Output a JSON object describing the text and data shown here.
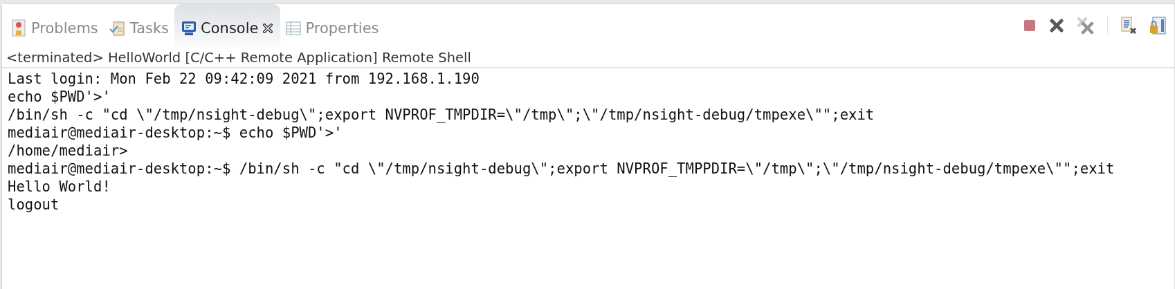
{
  "tabs": [
    {
      "label": "Problems",
      "kind": "problems",
      "selected": false
    },
    {
      "label": "Tasks",
      "kind": "tasks",
      "selected": false
    },
    {
      "label": "Console",
      "kind": "console",
      "selected": true
    },
    {
      "label": "Properties",
      "kind": "properties",
      "selected": false
    }
  ],
  "toolbar": [
    {
      "kind": "terminate",
      "disabled": true
    },
    {
      "kind": "remove",
      "disabled": false
    },
    {
      "kind": "remove-all",
      "disabled": true
    },
    {
      "kind": "clear",
      "disabled": false
    },
    {
      "kind": "scroll-lock",
      "disabled": false
    }
  ],
  "console": {
    "header": "<terminated> HelloWorld [C/C++ Remote Application] Remote Shell",
    "lines": [
      "Last login: Mon Feb 22 09:42:09 2021 from 192.168.1.190",
      "echo $PWD'>'",
      "/bin/sh -c \"cd \\\"/tmp/nsight-debug\\\";export NVPROF_TMPDIR=\\\"/tmp\\\";\\\"/tmp/nsight-debug/tmpexe\\\"\";exit",
      "mediair@mediair-desktop:~$ echo $PWD'>'",
      "/home/mediair>",
      "mediair@mediair-desktop:~$ /bin/sh -c \"cd \\\"/tmp/nsight-debug\\\";export NVPROF_TMPPDIR=\\\"/tmp\\\";\\\"/tmp/nsight-debug/tmpexe\\\"\";exit",
      "Hello World!",
      "logout"
    ]
  }
}
